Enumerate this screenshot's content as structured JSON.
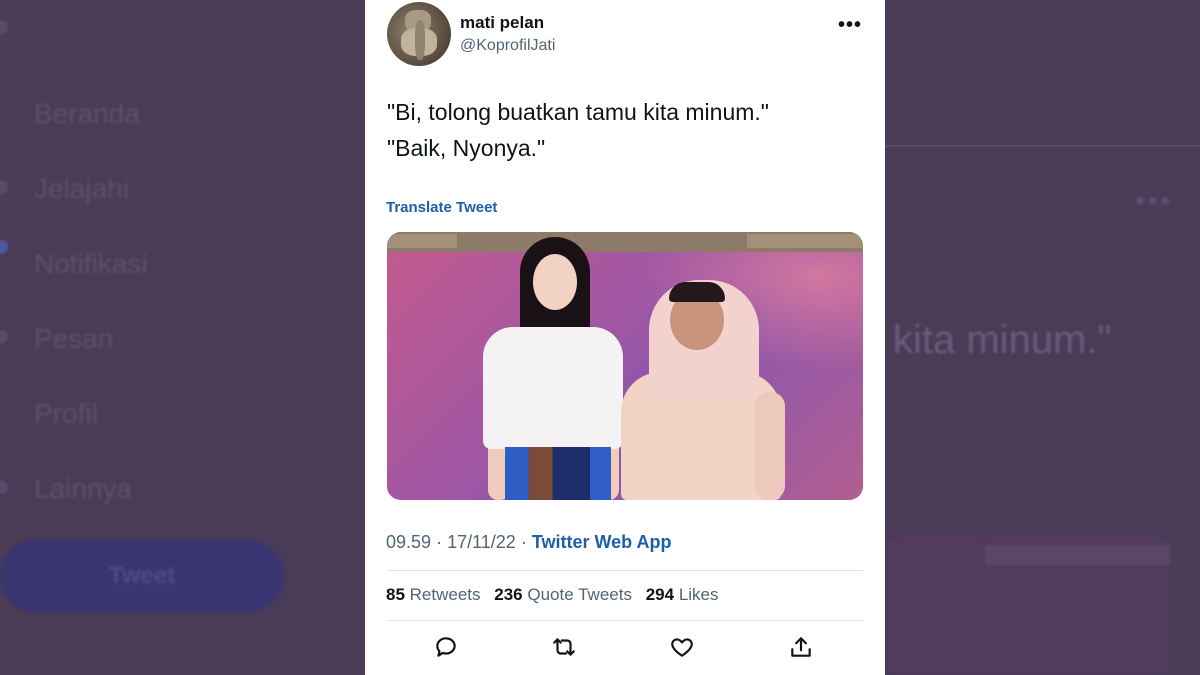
{
  "background": {
    "nav_items": [
      "Beranda",
      "Jelajahi",
      "Notifikasi",
      "Pesan",
      "Profil",
      "Lainnya"
    ],
    "tweet_button": "Tweet",
    "right_fragment_text": "kita minum.\""
  },
  "tweet": {
    "author_name": "mati pelan",
    "author_handle": "@KoprofilJati",
    "more_icon": "more-horizontal-icon",
    "text_line_1": "\"Bi, tolong buatkan tamu kita minum.\"",
    "text_line_2": "\"Baik, Nyonya.\"",
    "translate_label": "Translate Tweet",
    "time": "09.59",
    "separator": "·",
    "date": "17/11/22",
    "source": "Twitter Web App",
    "retweets_count": "85",
    "retweets_label": "Retweets",
    "quote_count": "236",
    "quote_label": "Quote Tweets",
    "likes_count": "294",
    "likes_label": "Likes"
  },
  "actions": [
    "reply-icon",
    "retweet-icon",
    "like-icon",
    "share-icon"
  ],
  "colors": {
    "link": "#1d5fa8",
    "text": "#0f1419",
    "muted": "#536471",
    "background_overlay": "#4a3b56"
  }
}
